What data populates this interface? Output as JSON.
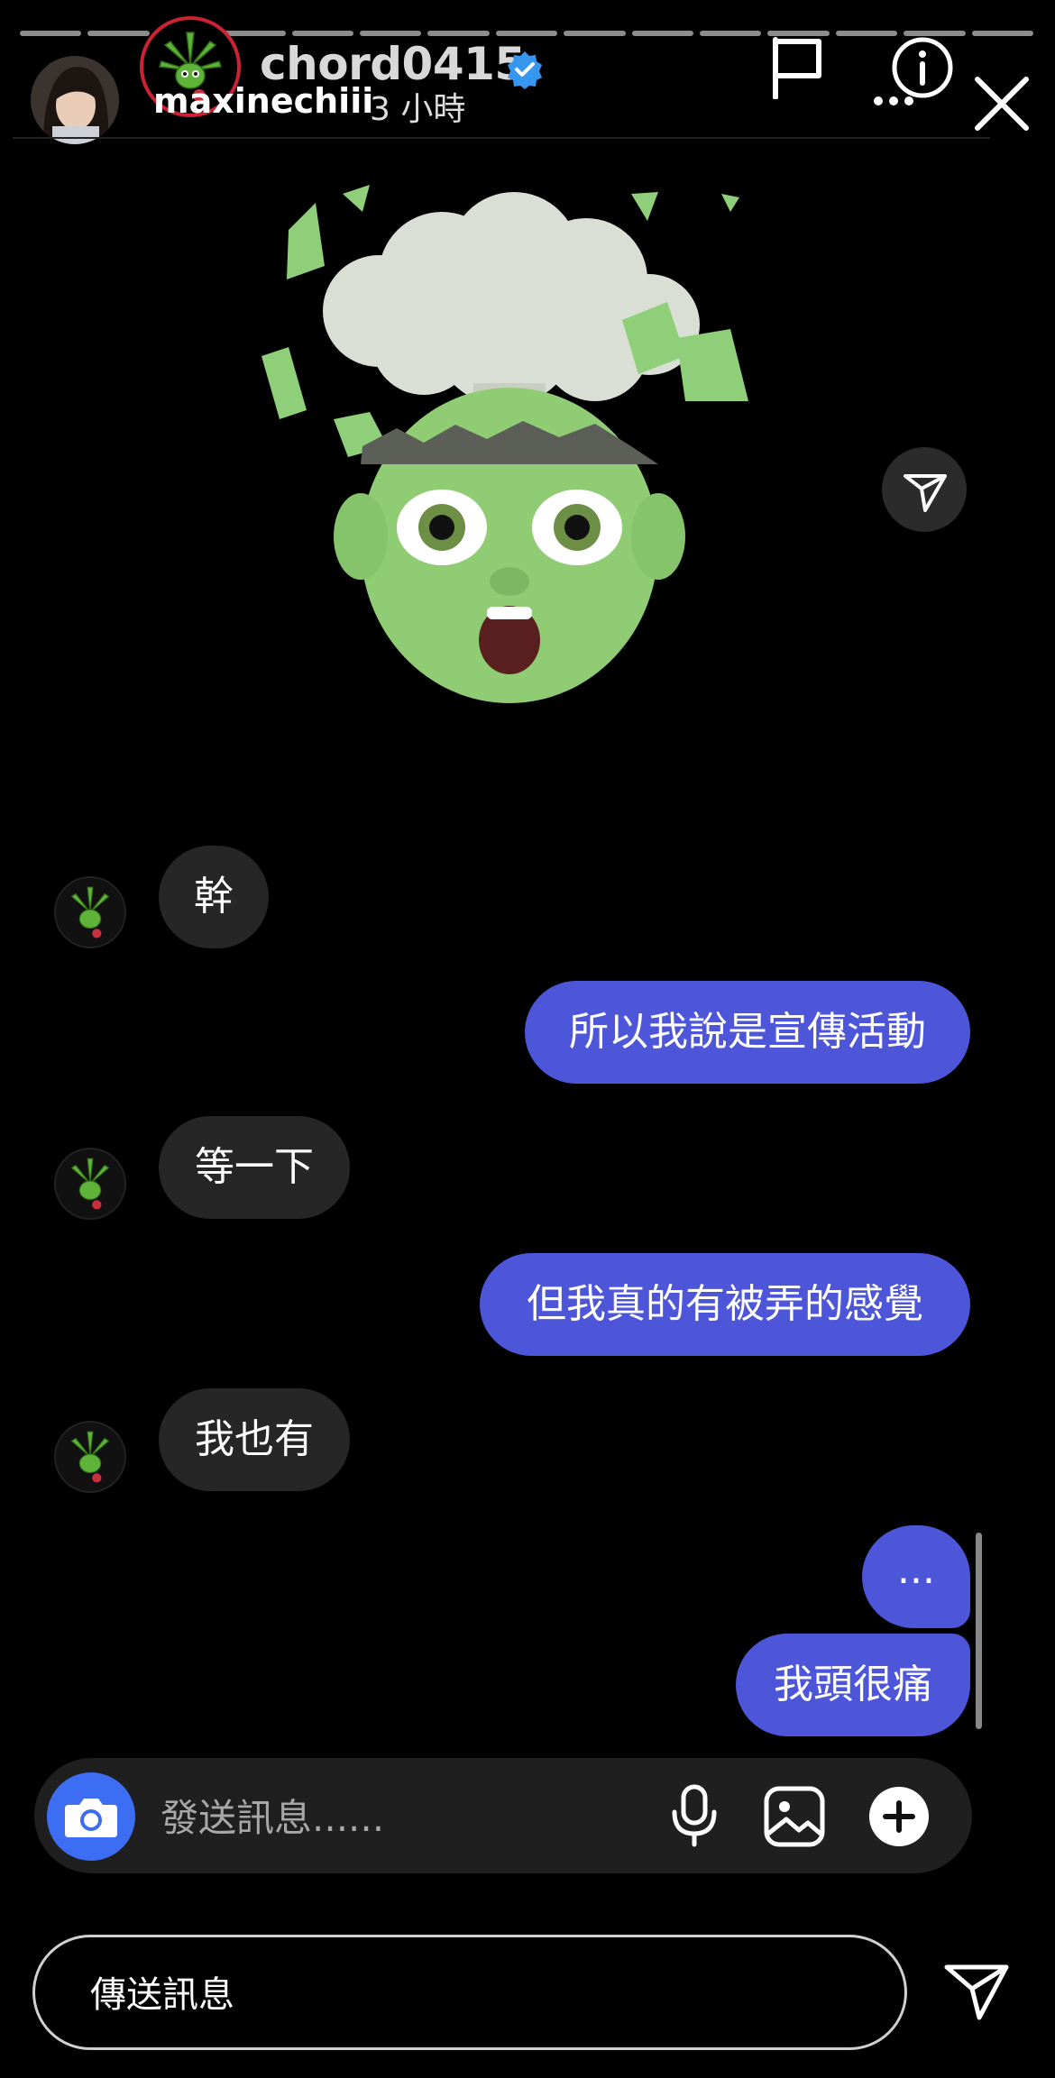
{
  "header": {
    "username_top": "chord0415",
    "username_bottom": "maxinechiii",
    "time_ago": "3 小時",
    "progress_segments": 15
  },
  "messages": [
    {
      "dir": "in",
      "text": "幹"
    },
    {
      "dir": "out",
      "text": "所以我說是宣傳活動"
    },
    {
      "dir": "in",
      "text": "等一下"
    },
    {
      "dir": "out",
      "text": "但我真的有被弄的感覺"
    },
    {
      "dir": "in",
      "text": "我也有"
    },
    {
      "dir": "out",
      "text": "..."
    },
    {
      "dir": "out",
      "text": "我頭很痛"
    }
  ],
  "composer": {
    "placeholder": "發送訊息......"
  },
  "story_reply": {
    "label": "傳送訊息"
  },
  "colors": {
    "outgoing_bubble": "#4d55d9",
    "incoming_bubble": "#262626",
    "camera_button": "#3d6df2"
  }
}
